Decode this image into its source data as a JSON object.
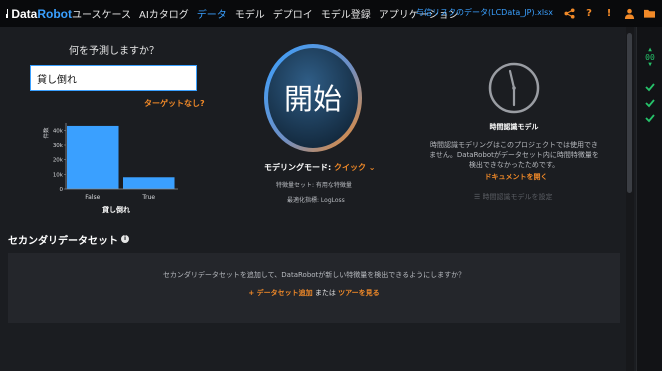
{
  "brand": {
    "name_part1": "Data",
    "name_part2": "Robot"
  },
  "nav": {
    "items": [
      {
        "label": "ユースケース"
      },
      {
        "label": "AIカタログ"
      },
      {
        "label": "データ"
      },
      {
        "label": "モデル"
      },
      {
        "label": "デプロイ"
      },
      {
        "label": "モデル登録"
      },
      {
        "label": "アプリケーション"
      }
    ],
    "active_index": 2
  },
  "project": {
    "name": "与信リスクのデータ(LCData_JP).xlsx"
  },
  "toolbar_icons": [
    "share-icon",
    "help-icon",
    "notification-icon",
    "user-icon",
    "folder-icon",
    "menu-icon"
  ],
  "target": {
    "question": "何を予測しますか？",
    "value": "貸し倒れ",
    "no_target_link": "ターゲットなし?"
  },
  "chart_data": {
    "type": "bar",
    "categories": [
      "False",
      "True"
    ],
    "values": [
      43000,
      8000
    ],
    "xlabel": "貸し倒れ",
    "ylabel": "件数",
    "yticks": [
      "0",
      "10k",
      "20k",
      "30k",
      "40k"
    ],
    "ylim": [
      0,
      45000
    ],
    "bar_color": "#3aa0ff",
    "grid": false
  },
  "start": {
    "label": "開始",
    "mode_label": "モデリングモード:",
    "mode_value": "クイック",
    "feature_set": "特徴量セット: 有用な特徴量",
    "metric": "最適化指標: LogLoss"
  },
  "time_series": {
    "title": "時間認識モデル",
    "description": "時間認識モデリングはこのプロジェクトでは使用できません。DataRobotがデータセット内に時間特徴量を検出できなかったためです。",
    "doc_link": "ドキュメントを開く",
    "settings_label": "時間認識モデルを設定"
  },
  "secondary": {
    "title": "セカンダリデータセット",
    "message": "セカンダリデータセットを追加して、DataRobotが新しい特徴量を検出できるようにしますか？",
    "add_link": "+ データセット追加",
    "or_text": " または ",
    "tour_link": "ツアーを見る"
  },
  "rail": {
    "counter": "00"
  },
  "colors": {
    "accent": "#3aa0ff",
    "orange": "#f28a28",
    "green": "#26c26a"
  }
}
